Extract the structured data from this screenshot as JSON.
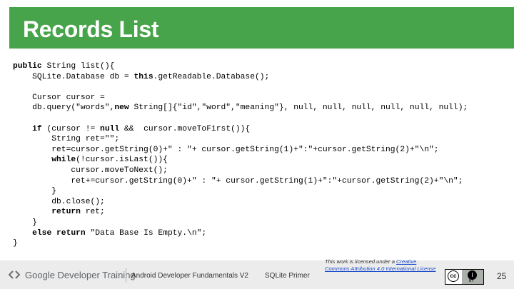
{
  "header": {
    "title": "Records List",
    "band_color": "#48a44a"
  },
  "code": {
    "lines": [
      [
        {
          "t": "public",
          "k": 1
        },
        {
          "t": " String list(){"
        }
      ],
      [
        {
          "t": "    SQLite.Database db = "
        },
        {
          "t": "this",
          "k": 1
        },
        {
          "t": ".getReadable.Database();"
        }
      ],
      [
        {
          "t": ""
        }
      ],
      [
        {
          "t": "    Cursor cursor ="
        }
      ],
      [
        {
          "t": "    db.query(\"words\","
        },
        {
          "t": "new",
          "k": 1
        },
        {
          "t": " String[]{\"id\",\"word\",\"meaning\"}, null, null, null, null, null, null);"
        }
      ],
      [
        {
          "t": ""
        }
      ],
      [
        {
          "t": "    "
        },
        {
          "t": "if",
          "k": 1
        },
        {
          "t": " (cursor != "
        },
        {
          "t": "null",
          "k": 1
        },
        {
          "t": " &&  cursor.moveToFirst()){"
        }
      ],
      [
        {
          "t": "        String ret=\"\";"
        }
      ],
      [
        {
          "t": "        ret=cursor.getString(0)+\" : \"+ cursor.getString(1)+\":\"+cursor.getString(2)+\"\\n\";"
        }
      ],
      [
        {
          "t": "        "
        },
        {
          "t": "while",
          "k": 1
        },
        {
          "t": "(!cursor.isLast()){"
        }
      ],
      [
        {
          "t": "            cursor.moveToNext();"
        }
      ],
      [
        {
          "t": "            ret+=cursor.getString(0)+\" : \"+ cursor.getString(1)+\":\"+cursor.getString(2)+\"\\n\";"
        }
      ],
      [
        {
          "t": "        }"
        }
      ],
      [
        {
          "t": "        db.close();"
        }
      ],
      [
        {
          "t": "        "
        },
        {
          "t": "return",
          "k": 1
        },
        {
          "t": " ret;"
        }
      ],
      [
        {
          "t": "    }"
        }
      ],
      [
        {
          "t": "    "
        },
        {
          "t": "else",
          "k": 1
        },
        {
          "t": " "
        },
        {
          "t": "return",
          "k": 1
        },
        {
          "t": " \"Data Base Is Empty.\\n\";"
        }
      ],
      [
        {
          "t": "}"
        }
      ]
    ]
  },
  "footer": {
    "brand": "Google Developer Training",
    "course": "Android Developer Fundamentals V2",
    "topic": "SQLite Primer",
    "license_prefix": "This work is licensed under a ",
    "license_link": "Creative Commons Attribution 4.0 International License",
    "cc_label": "cc",
    "by_label": "BY",
    "page_number": "25"
  }
}
